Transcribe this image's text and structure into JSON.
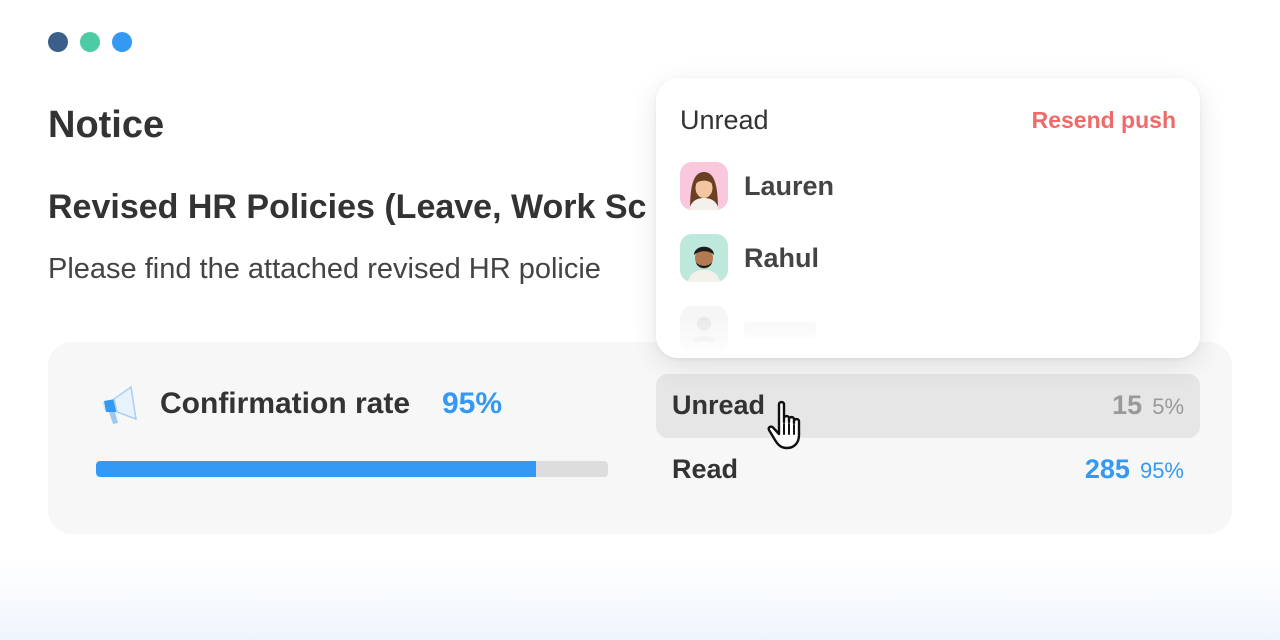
{
  "window": {
    "dot_colors": [
      "#3b5f8a",
      "#4ccba4",
      "#3399f3"
    ]
  },
  "notice": {
    "label": "Notice",
    "title": "Revised HR Policies (Leave, Work Sc",
    "body": "Please find the attached revised HR policie"
  },
  "confirmation": {
    "icon": "megaphone-icon",
    "label": "Confirmation rate",
    "rate_text": "95%",
    "progress_fraction": 0.86
  },
  "stats": [
    {
      "label": "Unread",
      "count": "15",
      "percent": "5%"
    },
    {
      "label": "Read",
      "count": "285",
      "percent": "95%"
    }
  ],
  "dropdown": {
    "title": "Unread",
    "action": "Resend push",
    "users": [
      {
        "name": "Lauren",
        "avatar_color": "#f9c8dc"
      },
      {
        "name": "Rahul",
        "avatar_color": "#bfe8dd"
      }
    ]
  },
  "colors": {
    "accent": "#3399f3",
    "danger": "#f06a6a"
  }
}
